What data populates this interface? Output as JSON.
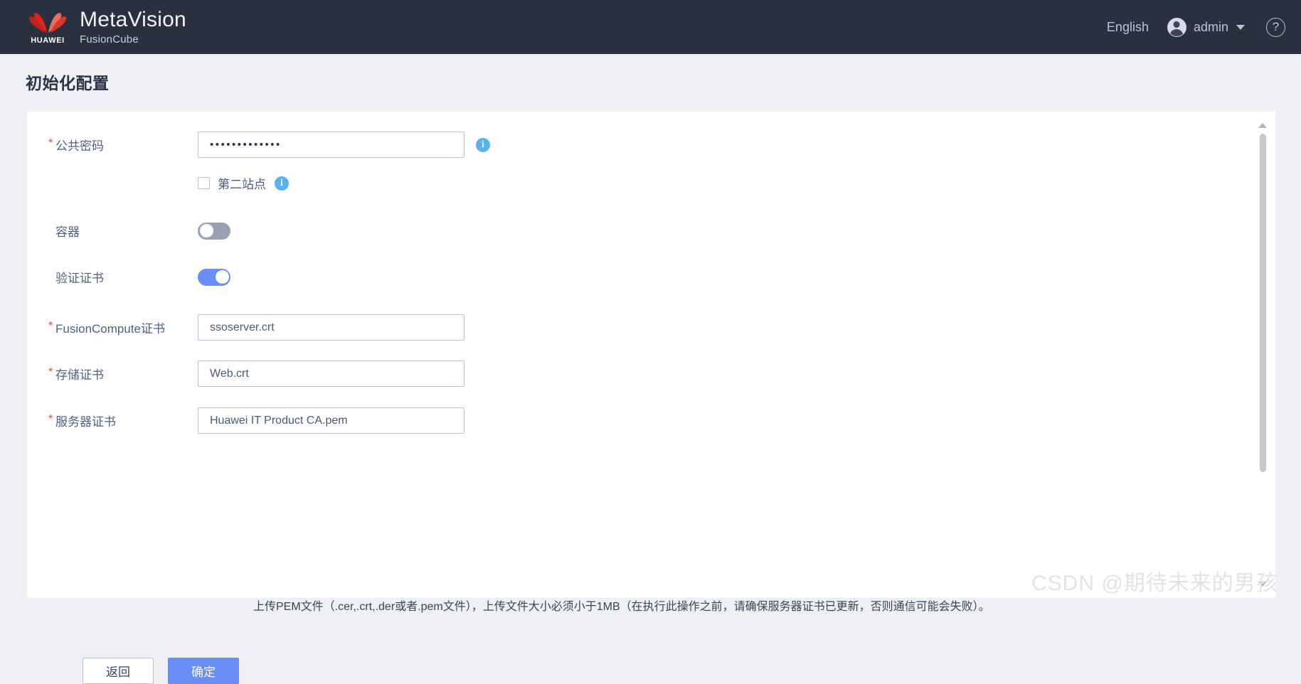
{
  "header": {
    "logo_text": "HUAWEI",
    "product_name": "MetaVision",
    "product_sub": "FusionCube",
    "language": "English",
    "user_name": "admin",
    "help_label": "?"
  },
  "page": {
    "title": "初始化配置"
  },
  "form": {
    "public_password": {
      "label": "公共密码",
      "required": true,
      "value": "•••••••••••••",
      "info_label": "i"
    },
    "second_site": {
      "label": "第二站点",
      "checked": false,
      "info_label": "i"
    },
    "container": {
      "label": "容器",
      "enabled": false
    },
    "verify_certificate": {
      "label": "验证证书",
      "enabled": true
    },
    "fusioncompute_cert": {
      "label": "FusionCompute证书",
      "required": true,
      "value": "ssoserver.crt"
    },
    "storage_cert": {
      "label": "存储证书",
      "required": true,
      "value": "Web.crt"
    },
    "server_cert": {
      "label": "服务器证书",
      "required": true,
      "value": "Huawei IT Product CA.pem"
    },
    "hint": "上传PEM文件（.cer,.crt,.der或者.pem文件），上传文件大小必须小于1MB（在执行此操作之前，请确保服务器证书已更新，否则通信可能会失败）。",
    "required_marker": "*"
  },
  "buttons": {
    "back": "返回",
    "confirm": "确定"
  },
  "watermark": "CSDN @期待未来的男孩",
  "colors": {
    "header_bg": "#2b3040",
    "accent": "#6a8ef5",
    "info": "#59b2ef",
    "required": "#e8453c",
    "page_bg": "#eef0f4"
  }
}
